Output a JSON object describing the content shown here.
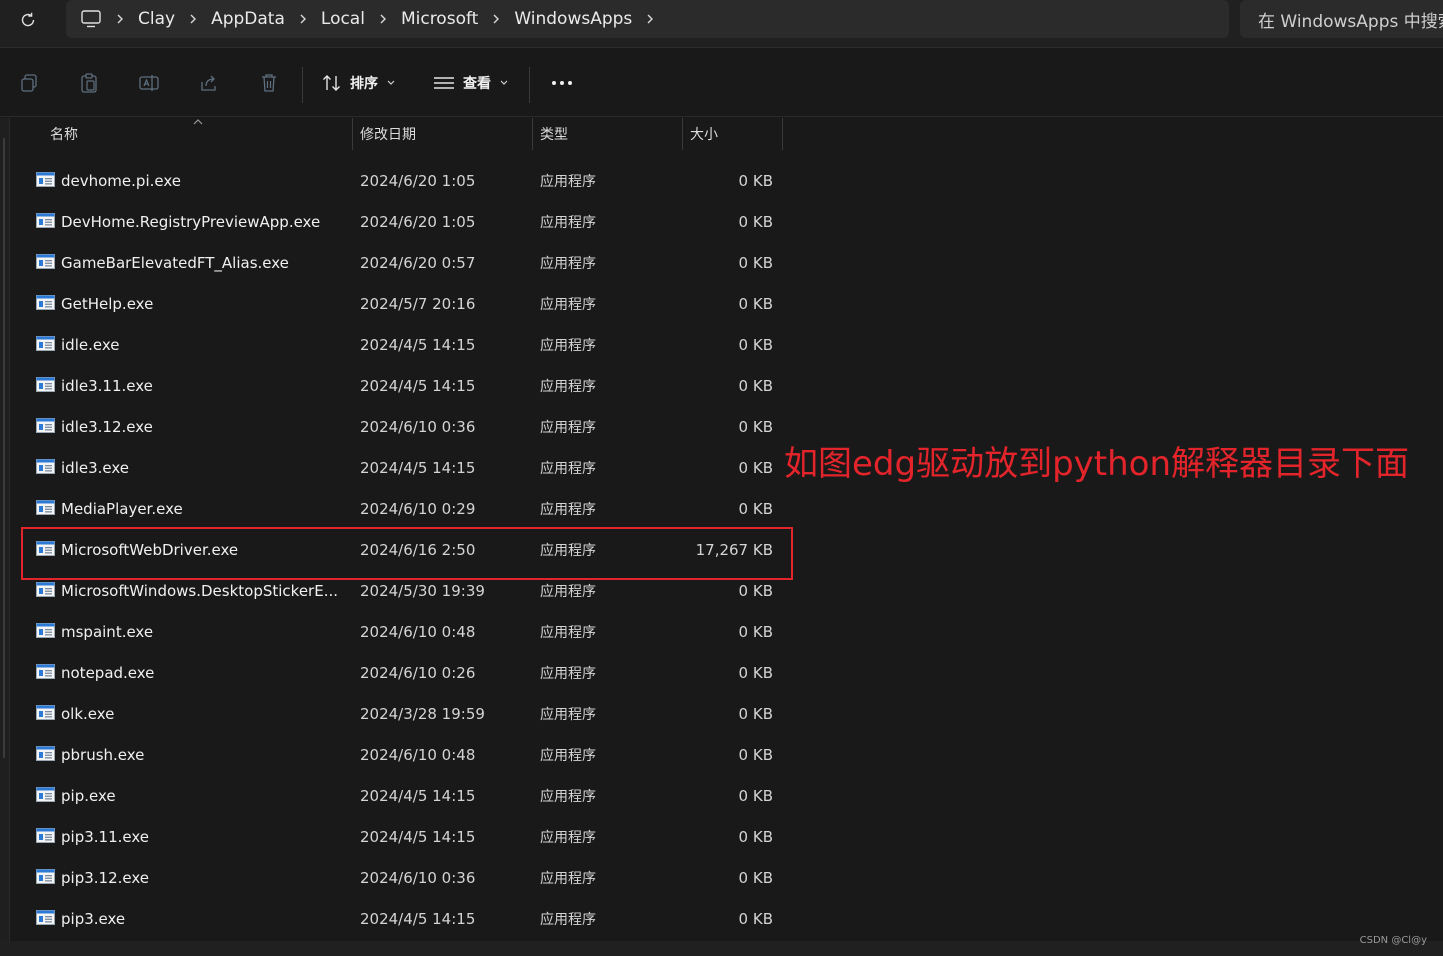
{
  "address_bar": {
    "breadcrumbs": [
      "Clay",
      "AppData",
      "Local",
      "Microsoft",
      "WindowsApps"
    ],
    "search_placeholder": "在 WindowsApps 中搜索"
  },
  "toolbar": {
    "sort_label": "排序",
    "view_label": "查看"
  },
  "columns": {
    "name": "名称",
    "date": "修改日期",
    "type": "类型",
    "size": "大小"
  },
  "files": [
    {
      "name": "devhome.pi.exe",
      "date": "2024/6/20 1:05",
      "type": "应用程序",
      "size": "0 KB"
    },
    {
      "name": "DevHome.RegistryPreviewApp.exe",
      "date": "2024/6/20 1:05",
      "type": "应用程序",
      "size": "0 KB"
    },
    {
      "name": "GameBarElevatedFT_Alias.exe",
      "date": "2024/6/20 0:57",
      "type": "应用程序",
      "size": "0 KB"
    },
    {
      "name": "GetHelp.exe",
      "date": "2024/5/7 20:16",
      "type": "应用程序",
      "size": "0 KB"
    },
    {
      "name": "idle.exe",
      "date": "2024/4/5 14:15",
      "type": "应用程序",
      "size": "0 KB"
    },
    {
      "name": "idle3.11.exe",
      "date": "2024/4/5 14:15",
      "type": "应用程序",
      "size": "0 KB"
    },
    {
      "name": "idle3.12.exe",
      "date": "2024/6/10 0:36",
      "type": "应用程序",
      "size": "0 KB"
    },
    {
      "name": "idle3.exe",
      "date": "2024/4/5 14:15",
      "type": "应用程序",
      "size": "0 KB"
    },
    {
      "name": "MediaPlayer.exe",
      "date": "2024/6/10 0:29",
      "type": "应用程序",
      "size": "0 KB"
    },
    {
      "name": "MicrosoftWebDriver.exe",
      "date": "2024/6/16 2:50",
      "type": "应用程序",
      "size": "17,267 KB"
    },
    {
      "name": "MicrosoftWindows.DesktopStickerE...",
      "date": "2024/5/30 19:39",
      "type": "应用程序",
      "size": "0 KB"
    },
    {
      "name": "mspaint.exe",
      "date": "2024/6/10 0:48",
      "type": "应用程序",
      "size": "0 KB"
    },
    {
      "name": "notepad.exe",
      "date": "2024/6/10 0:26",
      "type": "应用程序",
      "size": "0 KB"
    },
    {
      "name": "olk.exe",
      "date": "2024/3/28 19:59",
      "type": "应用程序",
      "size": "0 KB"
    },
    {
      "name": "pbrush.exe",
      "date": "2024/6/10 0:48",
      "type": "应用程序",
      "size": "0 KB"
    },
    {
      "name": "pip.exe",
      "date": "2024/4/5 14:15",
      "type": "应用程序",
      "size": "0 KB"
    },
    {
      "name": "pip3.11.exe",
      "date": "2024/4/5 14:15",
      "type": "应用程序",
      "size": "0 KB"
    },
    {
      "name": "pip3.12.exe",
      "date": "2024/6/10 0:36",
      "type": "应用程序",
      "size": "0 KB"
    },
    {
      "name": "pip3.exe",
      "date": "2024/4/5 14:15",
      "type": "应用程序",
      "size": "0 KB"
    }
  ],
  "annotation": {
    "text": "如图edg驱动放到python解释器目录下面",
    "color": "#e3242b"
  },
  "watermark": "CSDN @Cl@y"
}
